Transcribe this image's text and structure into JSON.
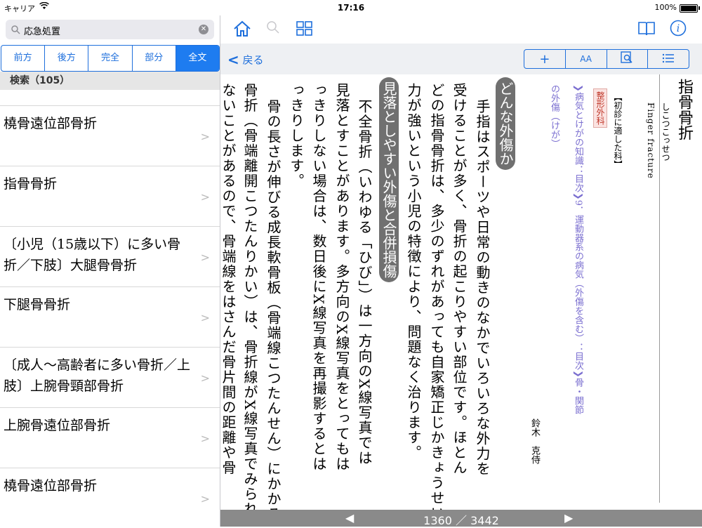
{
  "status": {
    "carrier": "キャリア",
    "time": "17:16",
    "battery": "100%"
  },
  "search": {
    "query": "応急処置",
    "clear": "✕"
  },
  "segments": [
    "前方",
    "後方",
    "完全",
    "部分",
    "全文"
  ],
  "section_header": "検索（105）",
  "results": [
    "橈骨遠位部骨折",
    "指骨骨折",
    "〔小児（15歳以下）に多い骨折／下肢〕大腿骨骨折",
    "下腿骨骨折",
    "〔成人～高齢者に多い骨折／上肢〕上腕骨頸部骨折",
    "上腕骨遠位部骨折",
    "橈骨遠位部骨折"
  ],
  "nav": {
    "back": "戻る",
    "buttons": [
      "+",
      "AA",
      "🔍",
      "☰"
    ]
  },
  "article": {
    "title": "指骨骨折",
    "reading": "しこつこっせつ",
    "english": "Finger fracture",
    "recommended": "【初診に適した科】",
    "department": "整形外科",
    "breadcrumb_1": "❯病気とけがの知識：目次❯9．運動器系の病気（外傷を含む）：目次❯骨・関節",
    "breadcrumb_2": "の外傷（けが）",
    "author": "鈴木　克侍",
    "heading_1": "どんな外傷か",
    "para1": [
      "手指はスポーツや日常の動きのなかでいろいろな外力を",
      "受けることが多く、骨折の起こりやすい部位です。ほとん",
      "どの指骨骨折は、多少のずれがあっても自家矯正じかきょうせい",
      "力が強いという小児の特徴により、問題なく治ります。"
    ],
    "heading_2": "見落としやすい外傷と合併損傷",
    "para2": [
      "不全骨折（いわゆる「ひび」）は一方向のX線写真では",
      "見落とすことがあります。多方向のX線写真をとってもは",
      "っきりしない場合は、数日後にX線写真を再撮影するとは",
      "っきりします。",
      "骨の長さが伸びる成長軟骨板（骨端線こつたんせん）にかかる",
      "骨折（骨端離開こつたんりかい）は、骨折線がX線写真でみられ",
      "ないことがあるので、骨端線をはさんだ骨片間の距離や骨"
    ]
  },
  "pager": {
    "current": "1360",
    "separator": "／",
    "total": "3442",
    "prev": "◀",
    "next": "▶"
  },
  "colors": {
    "accent": "#1e6fdc",
    "pill": "#707070",
    "meta": "#7b6fd0"
  }
}
